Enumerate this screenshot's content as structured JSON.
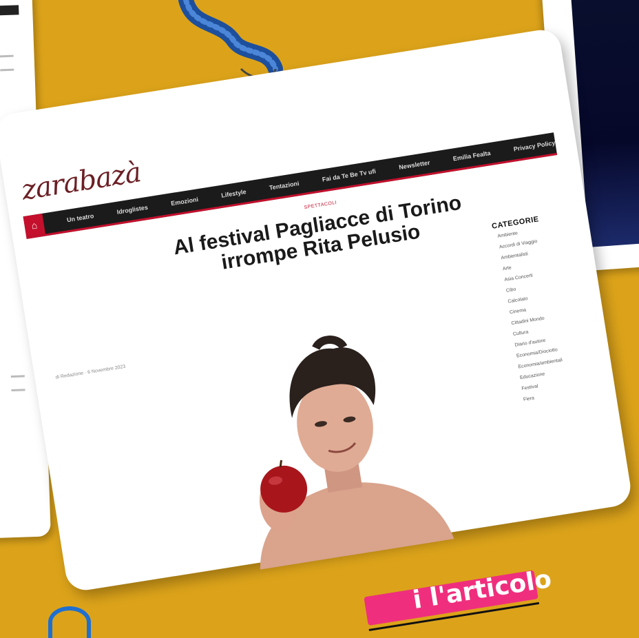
{
  "site": {
    "logo": "zarabazà",
    "home_icon": "home-icon",
    "nav": [
      "Un teatro",
      "Idroglistes",
      "Emozioni",
      "Lifestyle",
      "Tentazioni",
      "Fai da Te Be Tv ufi",
      "Newsletter",
      "Emilia Fealta",
      "Privacy Policy"
    ]
  },
  "article": {
    "category": "SPETTACOLI",
    "title_line1": "Al festival Pagliacce di Torino",
    "title_line2": "irrompe Rita Pelusio",
    "meta": "di Redazione · 6 Novembre 2023"
  },
  "sidebar": {
    "heading": "CATEGORIE",
    "items": [
      "Ambiente",
      "Accordi di Viaggio",
      "Ambientalisti",
      "Arte",
      "Asia Concerti",
      "Cibo",
      "Calcolato",
      "Cinema",
      "Cittadini Mondo",
      "Cultura",
      "Diario d'autore",
      "Economia/Diociotto",
      "Economia/ambientali",
      "Educazione",
      "Festival",
      "Fiera"
    ]
  },
  "banner": {
    "text": "i l'articolo",
    "color": "#ef2f7d"
  },
  "colors": {
    "background": "#dca31a",
    "nav_bg": "#1b1b1b",
    "accent_red": "#c4102d",
    "logo": "#6b1f24"
  }
}
